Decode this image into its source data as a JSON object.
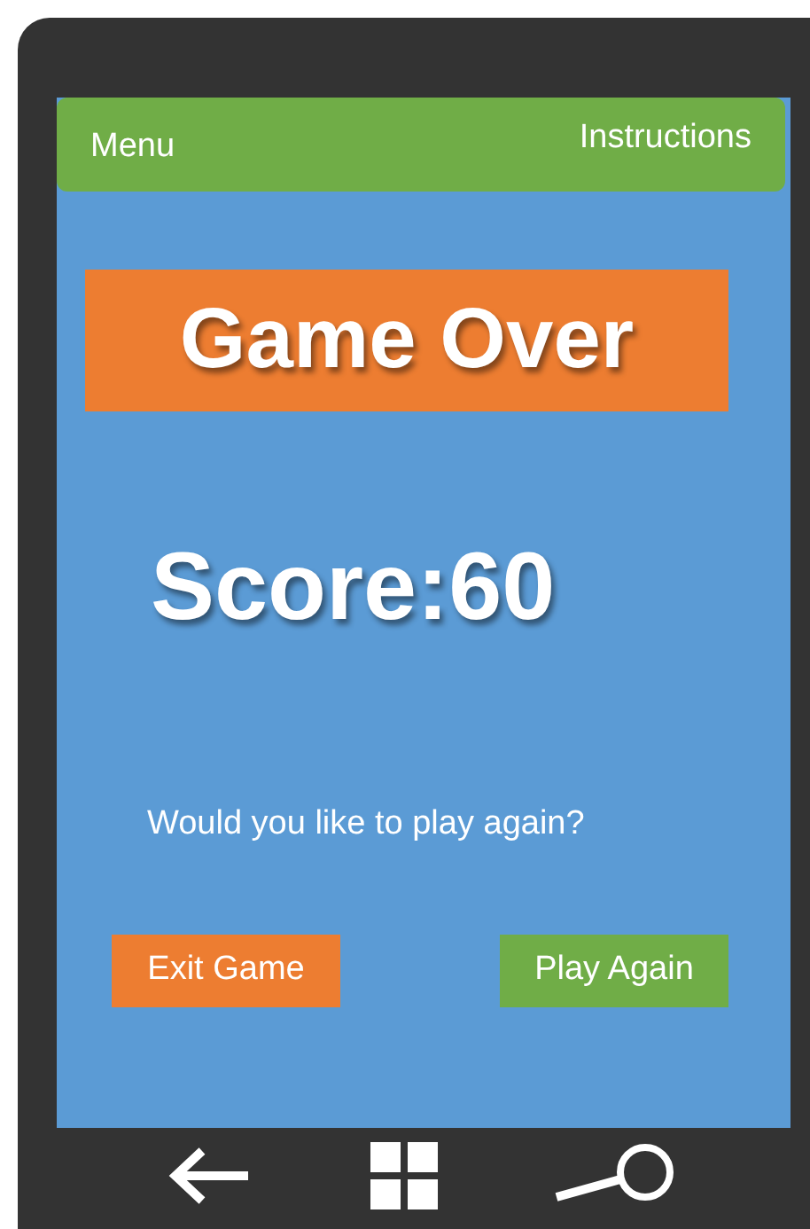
{
  "top_bar": {
    "menu": "Menu",
    "instructions": "Instructions"
  },
  "title": "Game Over",
  "score": "Score:60",
  "prompt": "Would you like to play again?",
  "buttons": [
    {
      "label": "Exit Game",
      "color": "#ed7d31"
    },
    {
      "label": "Play Again",
      "color": "#70ad47"
    }
  ]
}
